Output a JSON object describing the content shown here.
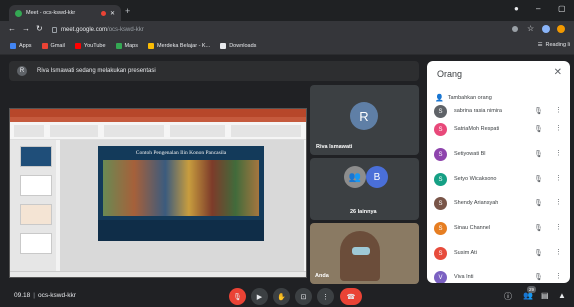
{
  "browser": {
    "tab_title": "Meet - ocs-kswd-kkr",
    "url_host": "meet.google.com",
    "url_path": "/ocs-kswd-kkr",
    "bookmarks": [
      {
        "label": "Apps",
        "color": "#4285f4"
      },
      {
        "label": "Gmail",
        "color": "#ea4335"
      },
      {
        "label": "YouTube",
        "color": "#ff0000"
      },
      {
        "label": "Maps",
        "color": "#34a853"
      },
      {
        "label": "Merdeka Belajar - K...",
        "color": "#fbbc04"
      },
      {
        "label": "Downloads",
        "color": "#e8eaed"
      }
    ],
    "reading_list": "Reading li"
  },
  "meet": {
    "presenting_avatar": "R",
    "presenting_text": "Riva Ismawati sedang melakukan presentasi",
    "slide_title": "Contoh Pengenalan Ilin Konon Pancasila",
    "tiles": {
      "presenter_initial": "R",
      "presenter_name": "Riva Ismawati",
      "presenter_color": "#5f7fa6",
      "others_initial": "B",
      "others_label": "26 lainnya",
      "others_color": "#4a6fd8",
      "self_name": "Anda"
    },
    "bottom": {
      "time": "09.18",
      "meeting_code": "ocs-kswd-kkr",
      "participants_count": "29"
    }
  },
  "people_panel": {
    "title": "Orang",
    "add_people": "Tambahkan orang",
    "people": [
      {
        "initial": "S",
        "name": "sabrina rasia nimira",
        "color": "#5f6368"
      },
      {
        "initial": "S",
        "name": "SatriaMoh Respati",
        "color": "#e8497a"
      },
      {
        "initial": "S",
        "name": "Setiyowati Bl",
        "color": "#8e44ad"
      },
      {
        "initial": "S",
        "name": "Setyo Wicaksono",
        "color": "#16a085"
      },
      {
        "initial": "S",
        "name": "Shendy Ariansyah",
        "color": "#795548"
      },
      {
        "initial": "S",
        "name": "Sinau Channel",
        "color": "#e67e22"
      },
      {
        "initial": "S",
        "name": "Susim Ati",
        "color": "#e74c3c"
      },
      {
        "initial": "V",
        "name": "Viva Inti",
        "color": "#7b61c2"
      }
    ]
  }
}
